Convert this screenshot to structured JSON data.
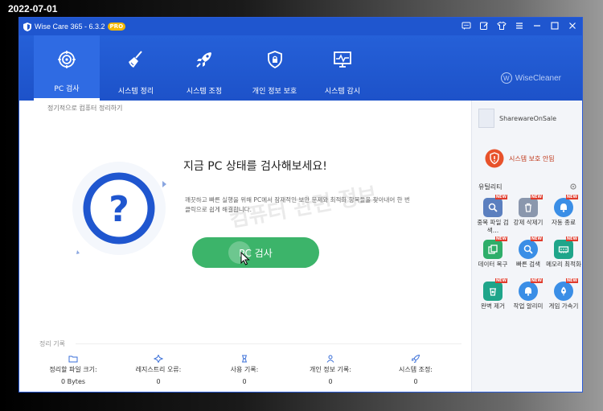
{
  "date_stamp": "2022-07-01",
  "titlebar": {
    "title": "Wise Care 365 - 6.3.2",
    "badge": "PRO"
  },
  "nav": {
    "items": [
      {
        "label": "PC 검사",
        "icon": "target-icon"
      },
      {
        "label": "시스템 정리",
        "icon": "broom-icon"
      },
      {
        "label": "시스템 조정",
        "icon": "rocket-icon"
      },
      {
        "label": "개인 정보 보호",
        "icon": "shield-lock-icon"
      },
      {
        "label": "시스템 감시",
        "icon": "monitor-icon"
      }
    ],
    "brand": "WiseCleaner",
    "brand_mark": "W"
  },
  "main": {
    "subtitle": "정기적으로 컴퓨터 정리하기",
    "headline": "지금 PC 상태를 검사해보세요!",
    "description": "깨끗하고 빠른 실행을 위해 PC에서 잠재적인 보안 문제와 최적화 항목들을 찾아내어 한 번 클릭으로 쉽게 해결합니다.",
    "watermark": "컴퓨터 관련 정보",
    "scan_button": "PC 검사",
    "records_title": "정리 기록",
    "stats": [
      {
        "label": "정리할 파일 크기:",
        "value": "0 Bytes",
        "icon": "folder-icon"
      },
      {
        "label": "레지스트리 오류:",
        "value": "0",
        "icon": "registry-icon"
      },
      {
        "label": "사용 기록:",
        "value": "0",
        "icon": "history-icon"
      },
      {
        "label": "개인 정보 기록:",
        "value": "0",
        "icon": "privacy-icon"
      },
      {
        "label": "시스템 조정:",
        "value": "0",
        "icon": "tune-icon"
      }
    ]
  },
  "sidebar": {
    "user_name": "SharewareOnSale",
    "protect_status": "시스템 보호 안됨",
    "util_title": "유틸리티",
    "new_badge": "NEW",
    "utilities": [
      {
        "label": "중복 파일 검색…",
        "color": "#5b7fbf"
      },
      {
        "label": "강제 삭제기",
        "color": "#8a97ad"
      },
      {
        "label": "자동 종료",
        "color": "#3a8ee6"
      },
      {
        "label": "데이터 복구",
        "color": "#2fae6a"
      },
      {
        "label": "빠른 검색",
        "color": "#3a8ee6"
      },
      {
        "label": "메모리 최적화",
        "color": "#1fa58a"
      },
      {
        "label": "완벽 제거",
        "color": "#1fa58a"
      },
      {
        "label": "작업 알리미",
        "color": "#3a8ee6"
      },
      {
        "label": "게임 가속기",
        "color": "#3a8ee6"
      }
    ]
  }
}
